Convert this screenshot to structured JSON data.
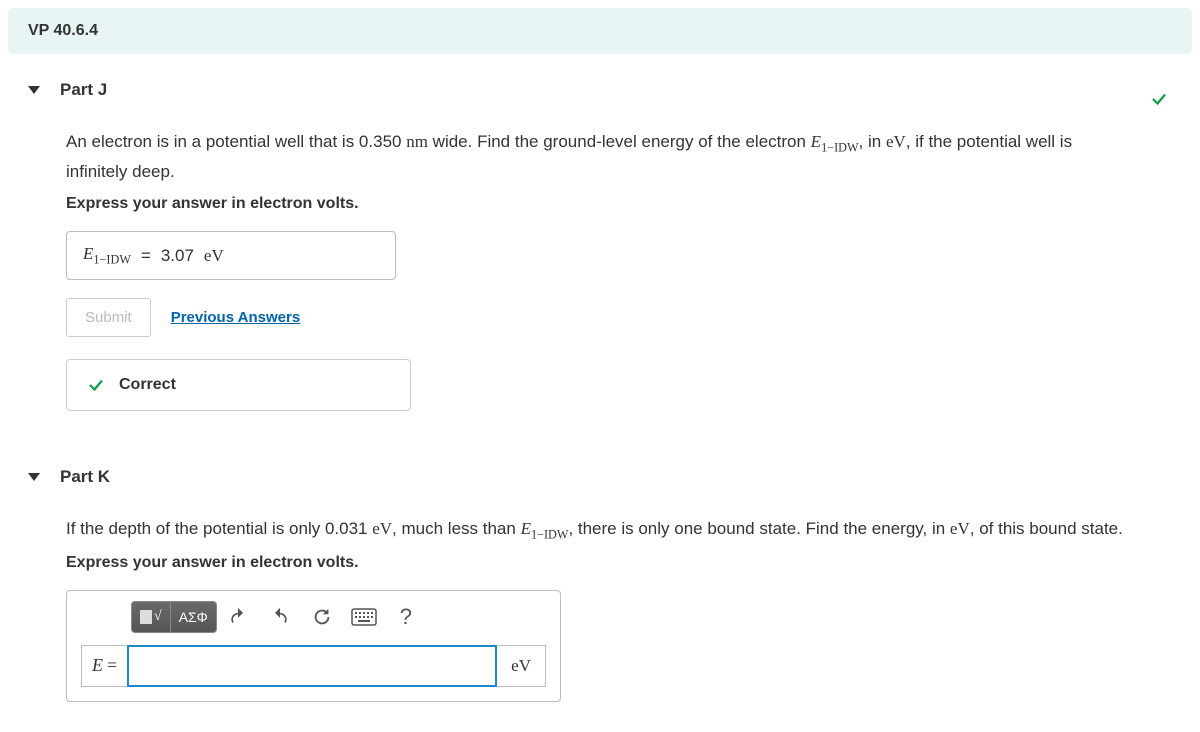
{
  "header": {
    "title": "VP 40.6.4"
  },
  "partJ": {
    "title": "Part J",
    "prompt_pre": "An electron is in a potential well that is 0.350 ",
    "prompt_nm": "nm",
    "prompt_mid": " wide. Find the ground-level energy of the electron ",
    "var_E": "E",
    "var_sub": "1−IDW",
    "prompt_mid2": ", in ",
    "unit_eV": "eV",
    "prompt_tail": ", if the potential well is infinitely deep.",
    "instruction": "Express your answer in electron volts.",
    "answer": {
      "lhs_E": "E",
      "lhs_sub": "1−IDW",
      "eq": "=",
      "value": "3.07",
      "unit": "eV"
    },
    "submit_label": "Submit",
    "previous_label": "Previous Answers",
    "correct_label": "Correct"
  },
  "partK": {
    "title": "Part K",
    "prompt_pre": "If the depth of the potential is only 0.031 ",
    "unit_eV": "eV",
    "prompt_mid": ", much less than ",
    "var_E": "E",
    "var_sub": "1−IDW",
    "prompt_mid2": ", there is only one bound state. Find the energy, in ",
    "prompt_tail": ", of this bound state.",
    "instruction": "Express your answer in electron volts.",
    "toolbar": {
      "greek": "ΑΣΦ",
      "help": "?"
    },
    "lhs": "E",
    "eq": "=",
    "unit": "eV",
    "input_value": ""
  }
}
